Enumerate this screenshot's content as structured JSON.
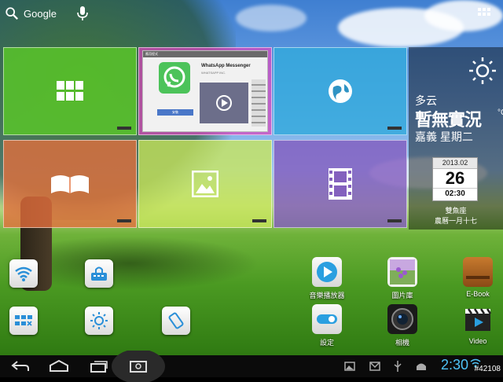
{
  "top": {
    "search_label": "Google"
  },
  "tiles": {
    "whatsapp": {
      "header": "應用程式",
      "title": "WhatsApp Messenger",
      "subtitle": "WHATSAPP INC.",
      "install_label": "安裝"
    }
  },
  "weather": {
    "condition": "多云",
    "status": "暫無實況",
    "unit": "°C",
    "city_day": "嘉義 星期二",
    "calendar_month": "2013.02",
    "calendar_day": "26",
    "calendar_time": "02:30",
    "zodiac": "雙魚座",
    "lunar_date": "農曆一月十七"
  },
  "apps": [
    {
      "label": "音樂播放器"
    },
    {
      "label": "圖片庫"
    },
    {
      "label": "E-Book"
    },
    {
      "label": "設定"
    },
    {
      "label": "相機"
    },
    {
      "label": "Video"
    }
  ],
  "status": {
    "clock": "2:30",
    "watermark": "#42108"
  },
  "colors": {
    "clock": "#4fc3f7",
    "tile_green": "#5ac828",
    "tile_pink": "#dc46be",
    "tile_blue": "#32aadc",
    "tile_orange": "#e66e3c",
    "tile_lime": "#c8e65a",
    "tile_purple": "#825abe"
  }
}
